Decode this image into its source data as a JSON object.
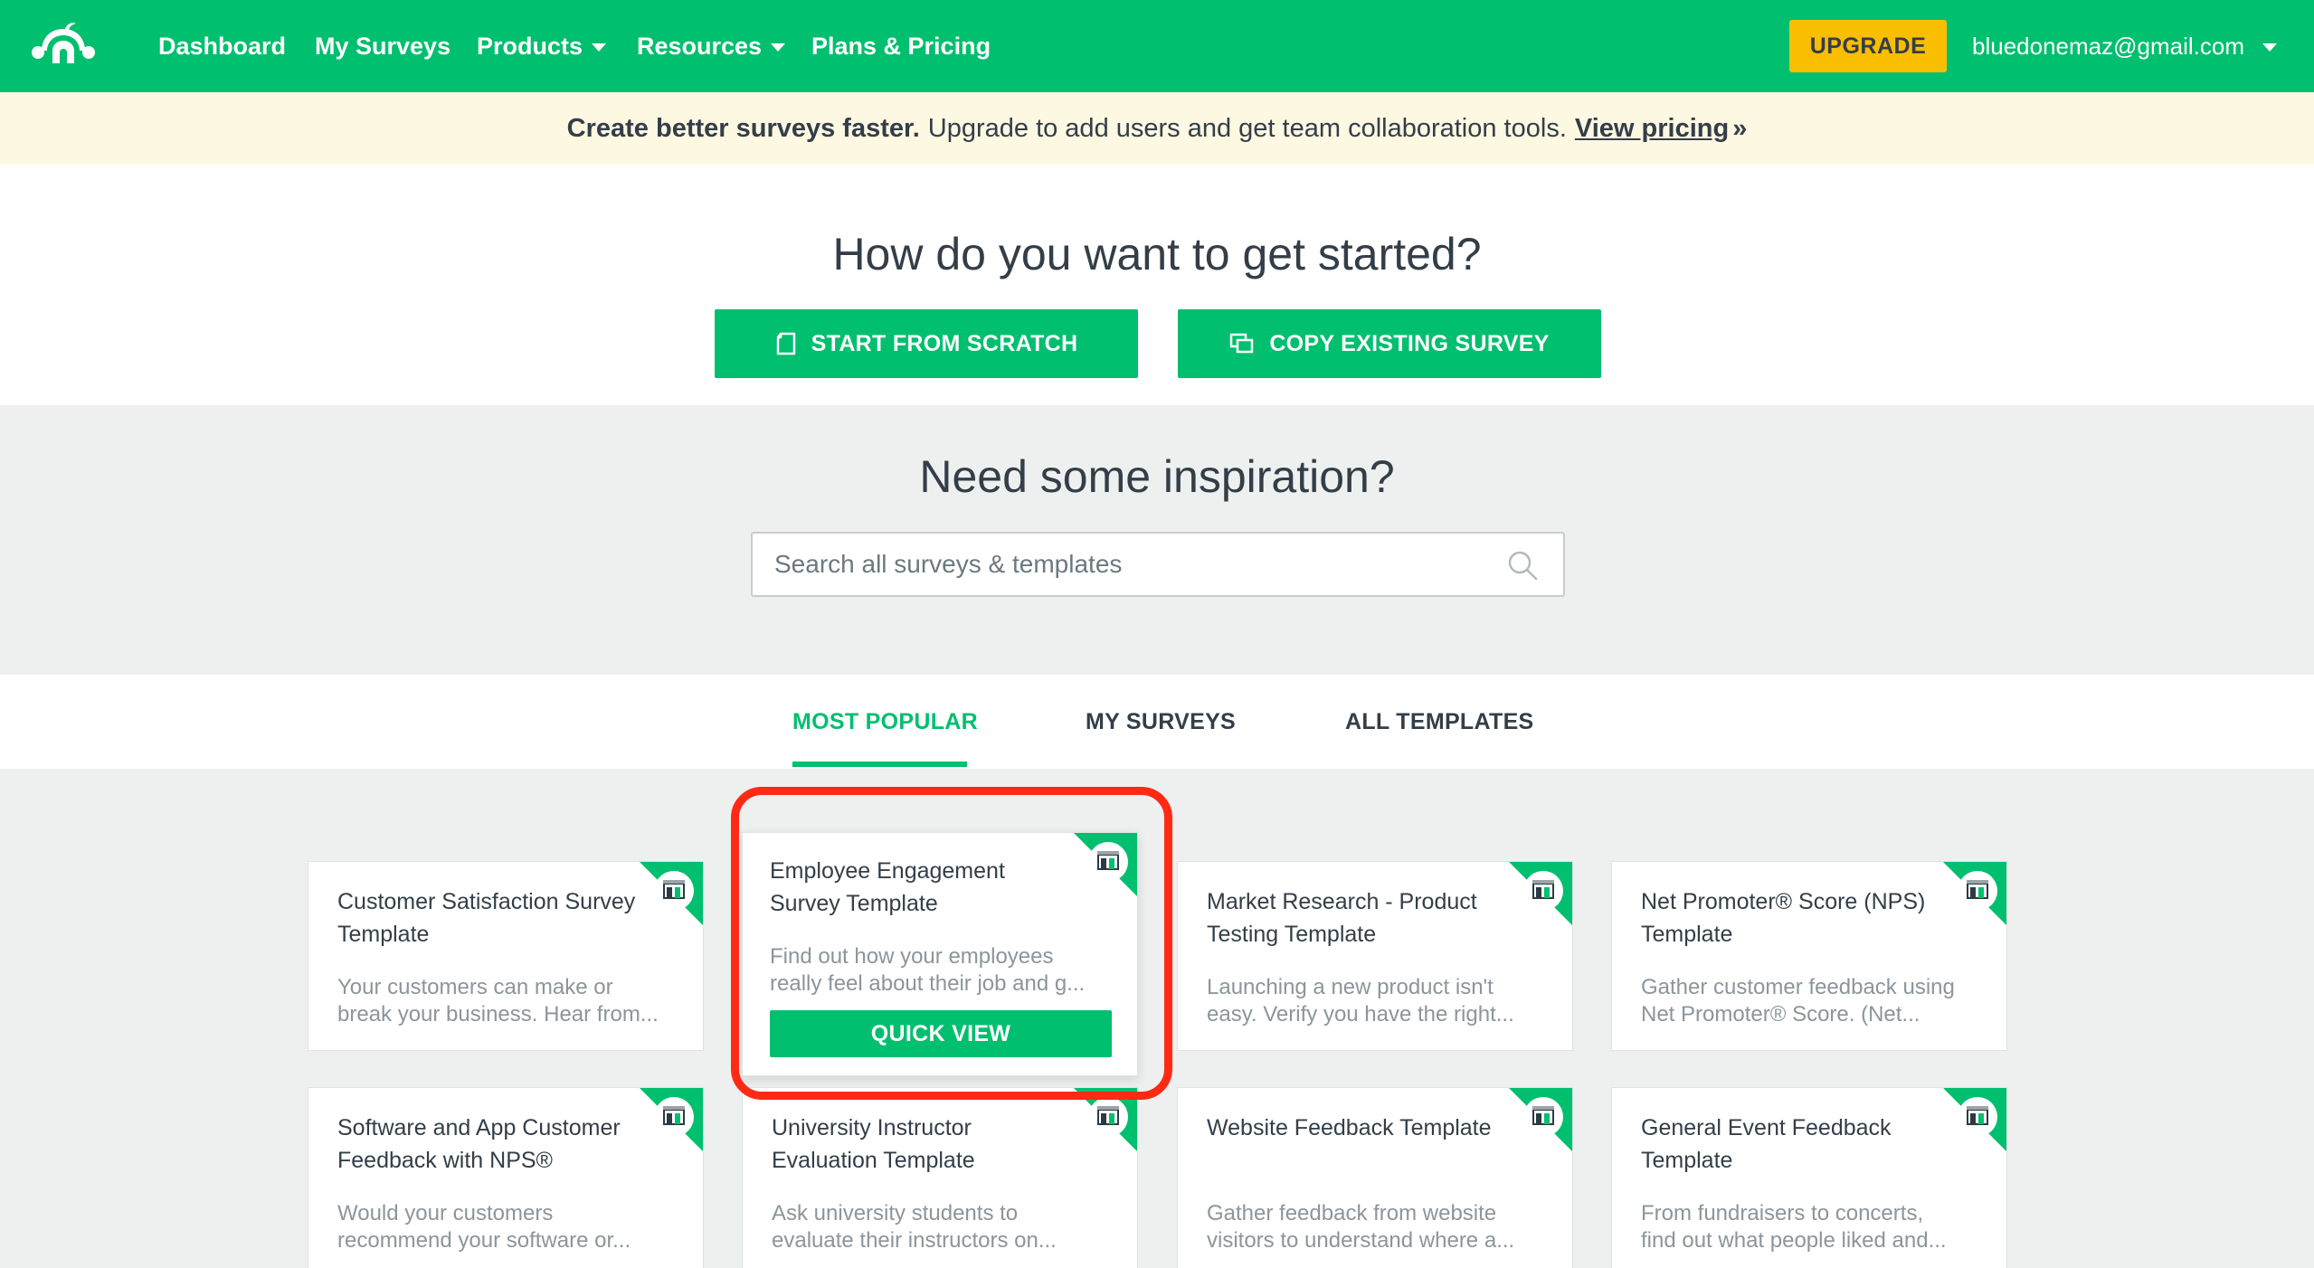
{
  "nav": {
    "links": [
      "Dashboard",
      "My Surveys",
      "Products",
      "Resources",
      "Plans & Pricing"
    ],
    "upgrade_label": "UPGRADE",
    "account_email": "bluedonemaz@gmail.com"
  },
  "banner": {
    "bold_text": "Create better surveys faster.",
    "text": "Upgrade to add users and get team collaboration tools.",
    "link_text": "View pricing",
    "arrow": "»"
  },
  "started": {
    "heading": "How do you want to get started?",
    "scratch_label": "START FROM SCRATCH",
    "copy_label": "COPY EXISTING SURVEY"
  },
  "inspiration": {
    "heading": "Need some inspiration?",
    "search_placeholder": "Search all surveys & templates"
  },
  "tabs": [
    "MOST POPULAR",
    "MY SURVEYS",
    "ALL TEMPLATES"
  ],
  "cards": [
    {
      "title": "Customer Satisfaction Survey Template",
      "desc1": "Your customers can make or",
      "desc2": "break your business. Hear from..."
    },
    {
      "title": "Employee Engagement Survey Template",
      "desc1": "Find out how your employees",
      "desc2": "really feel about their job and g...",
      "button": "QUICK VIEW"
    },
    {
      "title": "Market Research - Product Testing Template",
      "desc1": "Launching a new product isn't",
      "desc2": "easy. Verify you have the right..."
    },
    {
      "title": "Net Promoter® Score (NPS) Template",
      "desc1": "Gather customer feedback using",
      "desc2": "Net Promoter® Score. (Net..."
    },
    {
      "title": "Software and App Customer Feedback with NPS®",
      "desc1": "Would your customers",
      "desc2": "recommend your software or..."
    },
    {
      "title": "University Instructor Evaluation Template",
      "desc1": "Ask university students to",
      "desc2": "evaluate their instructors on..."
    },
    {
      "title": "Website Feedback Template",
      "desc1": "Gather feedback from website",
      "desc2": "visitors to understand where a..."
    },
    {
      "title": "General Event Feedback Template",
      "desc1": "From fundraisers to concerts,",
      "desc2": "find out what people liked and..."
    }
  ],
  "colors": {
    "brand_green": "#00bf6f",
    "upgrade_yellow": "#f9be00",
    "banner_bg": "#fdf8e2",
    "highlight_red": "#ff2a14"
  },
  "icons": [
    "surveymonkey-logo-icon",
    "caret-down-icon",
    "document-icon",
    "copy-icon",
    "search-icon",
    "template-badge-icon"
  ]
}
